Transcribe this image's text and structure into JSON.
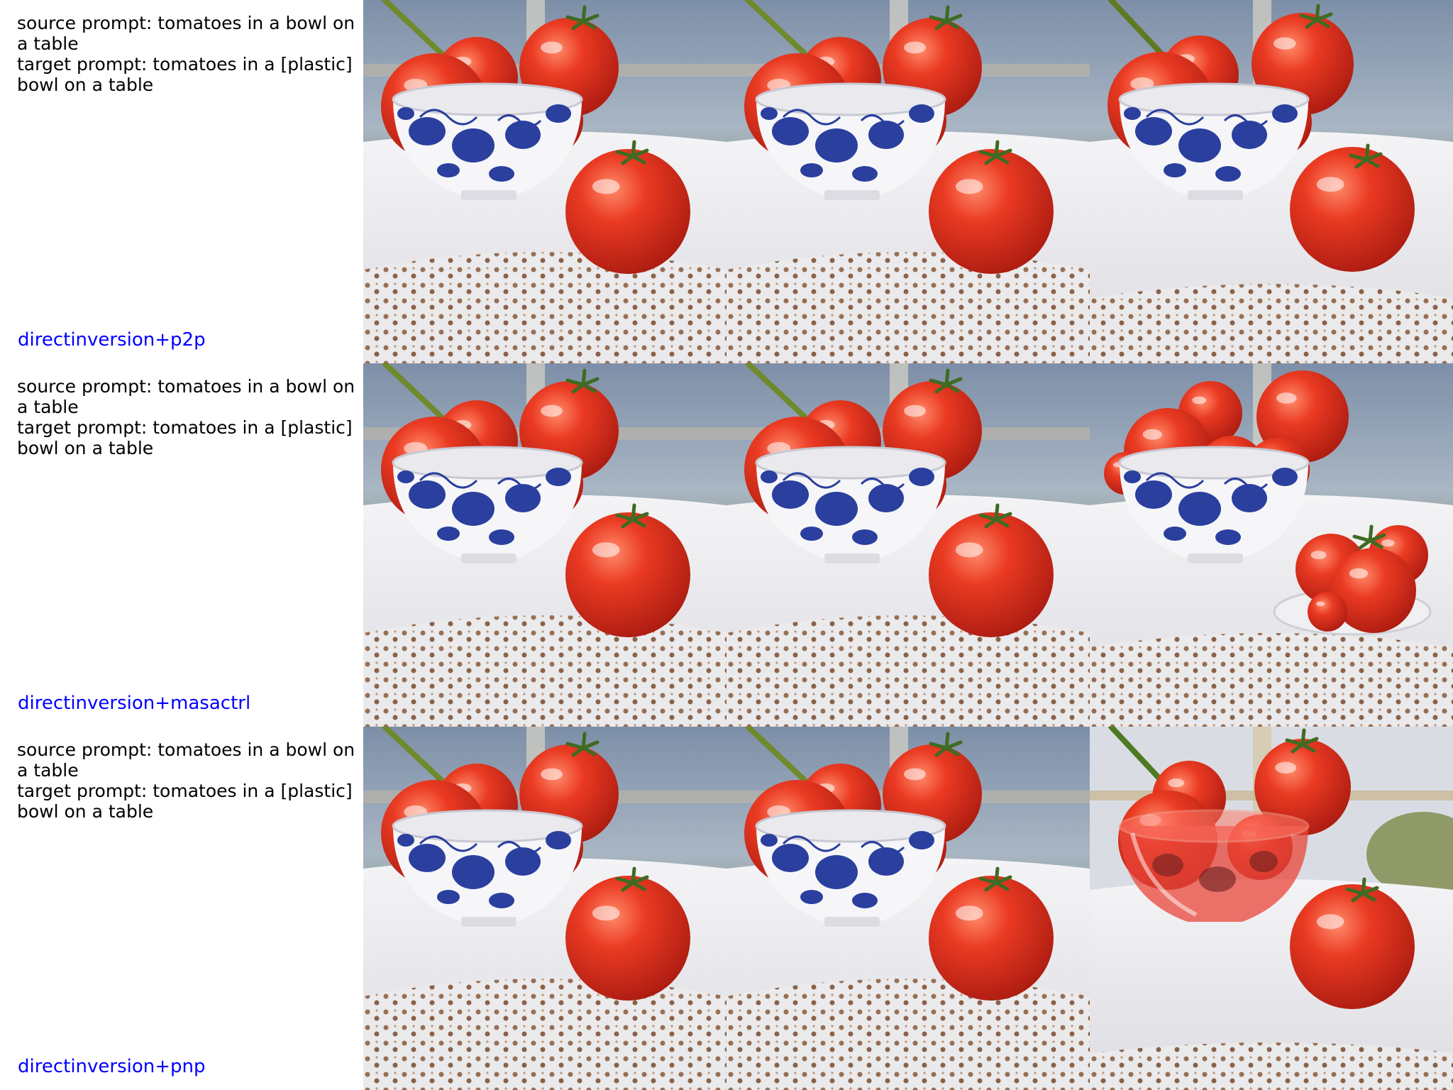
{
  "rows": [
    {
      "source_prompt": "source prompt: tomatoes in a bowl on a table",
      "target_prompt": "target prompt: tomatoes in a [plastic] bowl on a table",
      "method": "directinversion+p2p"
    },
    {
      "source_prompt": "source prompt: tomatoes in a bowl on a table",
      "target_prompt": "target prompt: tomatoes in a [plastic] bowl on a table",
      "method": "directinversion+masactrl"
    },
    {
      "source_prompt": "source prompt: tomatoes in a bowl on a table",
      "target_prompt": "target prompt: tomatoes in a [plastic] bowl on a table",
      "method": "directinversion+pnp"
    }
  ],
  "colors": {
    "method_label": "#0000ff",
    "tomato": "#e0321f",
    "bowl_pattern": "#2a3f9e",
    "cloth": "#f2f2f2",
    "plastic_bowl": "#e8453a"
  }
}
